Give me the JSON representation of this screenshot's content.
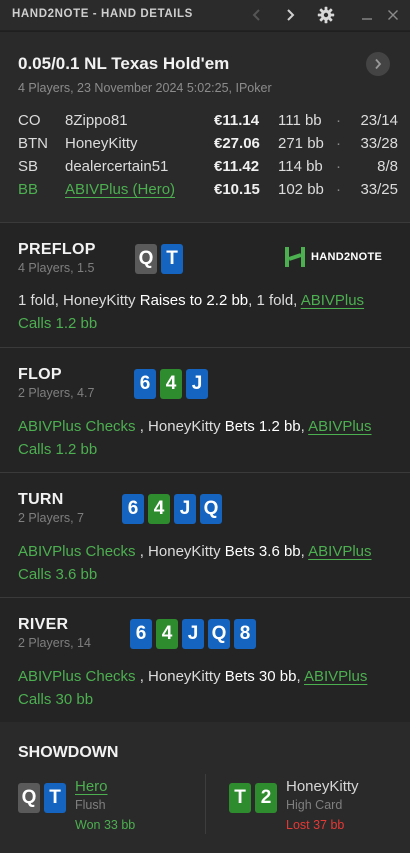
{
  "window": {
    "title": "HAND2NOTE - HAND DETAILS"
  },
  "header": {
    "game": "0.05/0.1 NL Texas Hold'em",
    "subtitle": "4 Players, 23 November 2024 5:02:25, IPoker"
  },
  "players": [
    {
      "pos": "CO",
      "name": "8Zippo81",
      "stack": "€11.14",
      "bb": "111 bb",
      "dot": "·",
      "stat": "23/14",
      "hero": false
    },
    {
      "pos": "BTN",
      "name": "HoneyKitty",
      "stack": "€27.06",
      "bb": "271 bb",
      "dot": "·",
      "stat": "33/28",
      "hero": false
    },
    {
      "pos": "SB",
      "name": "dealercertain51",
      "stack": "€11.42",
      "bb": "114 bb",
      "dot": "·",
      "stat": "8/8",
      "hero": false
    },
    {
      "pos": "BB",
      "name": "ABIVPlus (Hero)",
      "stack": "€10.15",
      "bb": "102 bb",
      "dot": "·",
      "stat": "33/25",
      "hero": true
    }
  ],
  "brand": {
    "text": "HAND2NOTE",
    "color": "#4caf50"
  },
  "streets": {
    "preflop": {
      "name": "PREFLOP",
      "sub": "4 Players, 1.5",
      "cards": [
        {
          "rank": "Q",
          "suit": "spade"
        },
        {
          "rank": "T",
          "suit": "diamond"
        }
      ],
      "action": {
        "p1": "1 fold, HoneyKitty ",
        "p2": "Raises to 2.2 bb",
        "p3": ", 1 fold, ",
        "p4": "ABIVPlus",
        "p5": "Calls 1.2 bb"
      }
    },
    "flop": {
      "name": "FLOP",
      "sub": "2 Players, 4.7",
      "cards": [
        {
          "rank": "6",
          "suit": "diamond"
        },
        {
          "rank": "4",
          "suit": "club"
        },
        {
          "rank": "J",
          "suit": "diamond"
        }
      ],
      "action": {
        "p1": "ABIVPlus Checks",
        "p2": " , HoneyKitty ",
        "p3": "Bets 1.2 bb",
        "p4": ", ",
        "p5": "ABIVPlus",
        "p6": "Calls 1.2 bb"
      }
    },
    "turn": {
      "name": "TURN",
      "sub": "2 Players, 7",
      "cards": [
        {
          "rank": "6",
          "suit": "diamond"
        },
        {
          "rank": "4",
          "suit": "club"
        },
        {
          "rank": "J",
          "suit": "diamond"
        },
        {
          "rank": "Q",
          "suit": "diamond"
        }
      ],
      "action": {
        "p1": "ABIVPlus Checks",
        "p2": " , HoneyKitty ",
        "p3": "Bets 3.6 bb",
        "p4": ", ",
        "p5": "ABIVPlus",
        "p6": "Calls 3.6 bb"
      }
    },
    "river": {
      "name": "RIVER",
      "sub": "2 Players, 14",
      "cards": [
        {
          "rank": "6",
          "suit": "diamond"
        },
        {
          "rank": "4",
          "suit": "club"
        },
        {
          "rank": "J",
          "suit": "diamond"
        },
        {
          "rank": "Q",
          "suit": "diamond"
        },
        {
          "rank": "8",
          "suit": "club"
        }
      ],
      "action": {
        "p1": "ABIVPlus Checks",
        "p2": " , HoneyKitty ",
        "p3": "Bets 30 bb",
        "p4": ", ",
        "p5": "ABIVPlus",
        "p6": "Calls 30 bb"
      }
    }
  },
  "showdown": {
    "title": "SHOWDOWN",
    "left": {
      "cards": [
        {
          "rank": "Q",
          "suit": "spade"
        },
        {
          "rank": "T",
          "suit": "diamond"
        }
      ],
      "name": "Hero",
      "hand": "Flush",
      "result": "Won 33 bb"
    },
    "right": {
      "cards": [
        {
          "rank": "T",
          "suit": "club"
        },
        {
          "rank": "2",
          "suit": "club"
        }
      ],
      "name": "HoneyKitty",
      "hand": "High Card",
      "result": "Lost 37 bb"
    }
  },
  "colors": {
    "spade": "#5a5a5a",
    "diamond": "#1565c0",
    "club": "#2e8b2e",
    "heart": "#c62828",
    "hero_green": "#4caf50",
    "loss_red": "#e53935"
  }
}
